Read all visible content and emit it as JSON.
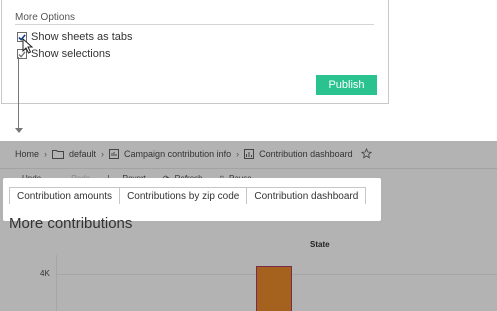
{
  "options": {
    "title": "More Options",
    "show_sheets_as_tabs": {
      "label": "Show sheets as tabs",
      "checked": true
    },
    "show_selections": {
      "label": "Show selections",
      "checked": true
    },
    "publish_label": "Publish"
  },
  "breadcrumb": {
    "home": "Home",
    "project": "default",
    "workbook": "Campaign contribution info",
    "view": "Contribution dashboard"
  },
  "toolbar": {
    "undo": "Undo",
    "redo": "Redo",
    "revert": "Revert",
    "refresh": "Refresh",
    "pause": "Pause"
  },
  "tabs": [
    {
      "label": "Contribution amounts"
    },
    {
      "label": "Contributions by zip code"
    },
    {
      "label": "Contribution dashboard"
    }
  ],
  "sheet": {
    "title": "More contributions"
  },
  "chart_data": {
    "type": "bar",
    "column_header": "State",
    "y_tick_labels": [
      "4K"
    ],
    "categories": [
      ""
    ],
    "values": [
      4300
    ],
    "bar_color": "#a5621f"
  },
  "colors": {
    "publish": "#2ac38f",
    "overlay": "#b3b3b3"
  }
}
